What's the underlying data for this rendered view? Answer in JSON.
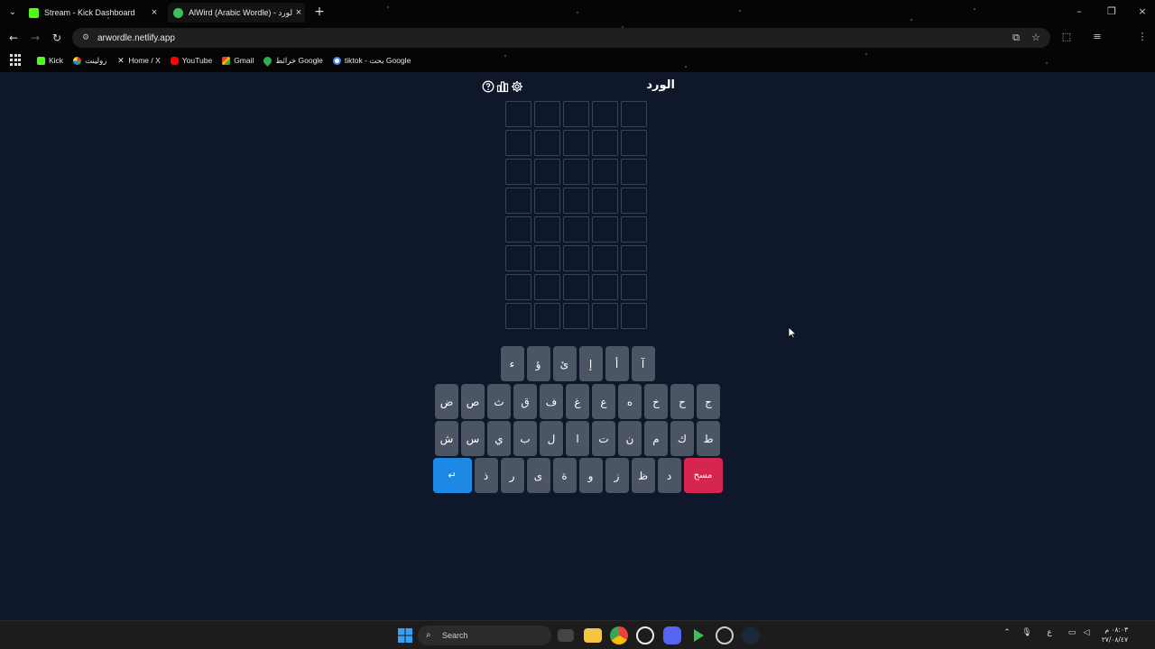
{
  "browser": {
    "tabs": [
      {
        "title": "Stream - Kick Dashboard",
        "favicon": "kick-icon",
        "color": "#53fc18"
      },
      {
        "title": "AlWird (Arabic Wordle) - الورد",
        "favicon": "alwird-icon",
        "color": "#3fbf5a"
      }
    ],
    "url": "arwordle.netlify.app",
    "bookmarks": [
      {
        "label": "Kick",
        "icon": "kick-icon"
      },
      {
        "label": "رولينت",
        "icon": "roulette-icon"
      },
      {
        "label": "Home / X",
        "icon": "x-icon"
      },
      {
        "label": "YouTube",
        "icon": "youtube-icon"
      },
      {
        "label": "Gmail",
        "icon": "gmail-icon"
      },
      {
        "label": "خرائط Google",
        "icon": "maps-icon"
      },
      {
        "label": "tiktok - بحث Google",
        "icon": "google-icon"
      }
    ]
  },
  "game": {
    "title": "الورد",
    "rows": 8,
    "cols": 5,
    "keyboard": {
      "row1": [
        "ء",
        "ؤ",
        "ئ",
        "إ",
        "أ",
        "آ"
      ],
      "row2": [
        "ض",
        "ص",
        "ث",
        "ق",
        "ف",
        "غ",
        "ع",
        "ه",
        "خ",
        "ح",
        "ج"
      ],
      "row3": [
        "ش",
        "س",
        "ي",
        "ب",
        "ل",
        "ا",
        "ت",
        "ن",
        "م",
        "ك",
        "ط"
      ],
      "enter": "↵",
      "row4": [
        "ذ",
        "ر",
        "ى",
        "ة",
        "و",
        "ز",
        "ظ",
        "د"
      ],
      "delete": "مسح"
    }
  },
  "taskbar": {
    "search_placeholder": "Search",
    "input_indicator": "ع",
    "time": "٠٨:٠٣ م",
    "date": "٢٧/٠٨/٤٧"
  },
  "colors": {
    "page_bg": "#0f172a",
    "key_bg": "#4b5563",
    "enter_bg": "#1e88e5",
    "delete_bg": "#d6254f",
    "cell_border": "#3a4459"
  }
}
